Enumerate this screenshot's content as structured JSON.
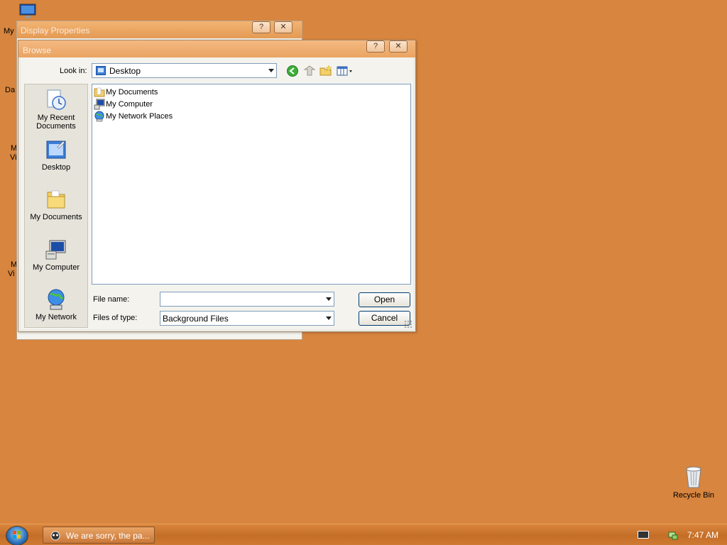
{
  "desktop": {
    "icons_left": [
      {
        "label": "My"
      },
      {
        "label": "Da"
      },
      {
        "label": "M"
      },
      {
        "label": "Vi"
      },
      {
        "label": "M"
      },
      {
        "label": "Vi"
      }
    ],
    "recycle_bin_label": "Recycle Bin"
  },
  "display_properties": {
    "title": "Display Properties",
    "help_label": "?",
    "close_label": "✕"
  },
  "browse": {
    "title": "Browse",
    "help_label": "?",
    "close_label": "✕",
    "look_in_label": "Look in:",
    "look_in_value": "Desktop",
    "toolbar": {
      "back_icon": "back-arrow-icon",
      "up_icon": "up-folder-icon",
      "new_folder_icon": "new-folder-icon",
      "views_icon": "views-menu-icon"
    },
    "places": [
      {
        "label": "My Recent Documents",
        "line1": "My Recent",
        "line2": "Documents"
      },
      {
        "label": "Desktop"
      },
      {
        "label": "My Documents"
      },
      {
        "label": "My Computer"
      },
      {
        "label": "My Network"
      }
    ],
    "files": [
      {
        "name": "My Documents"
      },
      {
        "name": "My Computer"
      },
      {
        "name": "My Network Places"
      }
    ],
    "file_name_label": "File name:",
    "file_name_value": "",
    "files_of_type_label": "Files of type:",
    "files_of_type_value": "Background Files",
    "open_label": "Open",
    "cancel_label": "Cancel"
  },
  "taskbar": {
    "task_label": "We are sorry, the pa...",
    "clock": "7:47 AM"
  },
  "colors": {
    "desktop": "#d7853f",
    "taskbar": "#c46e28",
    "title_text": "#fbeee2"
  }
}
